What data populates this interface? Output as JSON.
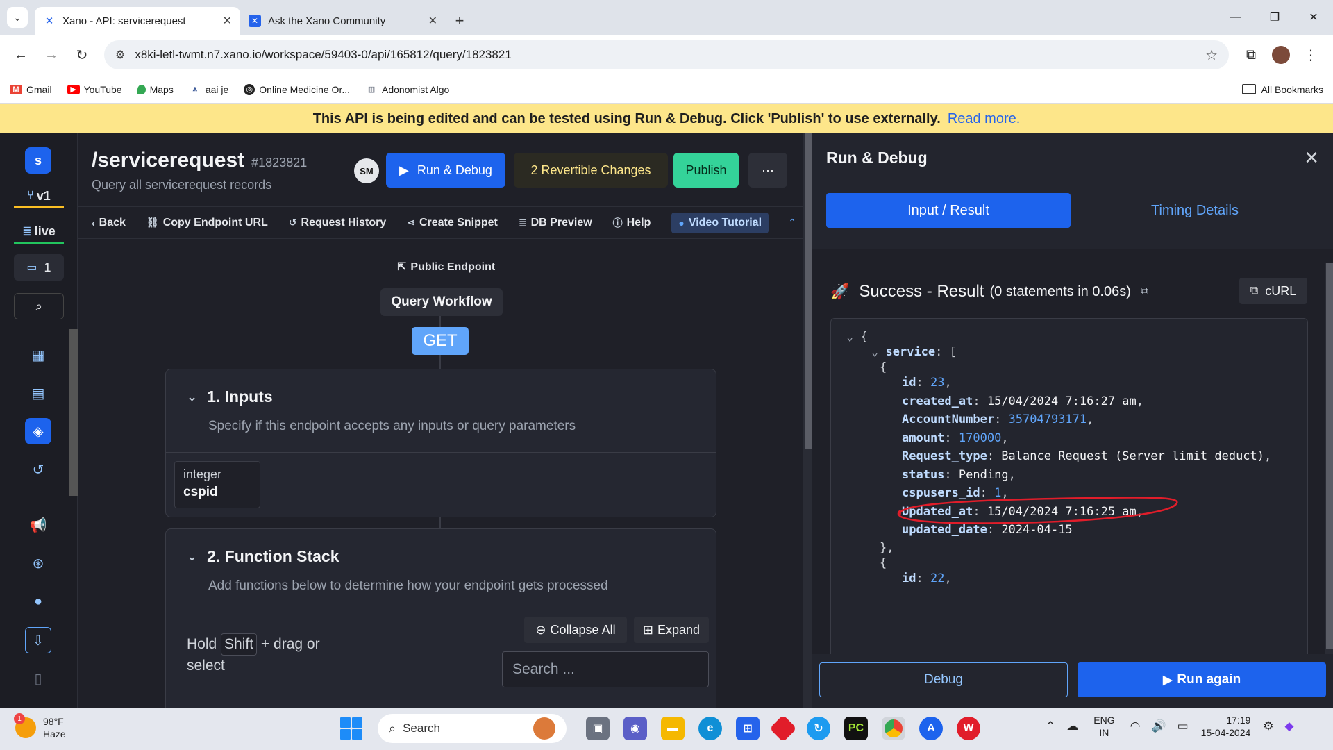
{
  "browser": {
    "tabs": [
      {
        "label": "Xano - API: servicerequest",
        "active": true
      },
      {
        "label": "Ask the Xano Community",
        "active": false
      }
    ],
    "url": "x8ki-letl-twmt.n7.xano.io/workspace/59403-0/api/165812/query/1823821",
    "bookmarks": [
      {
        "label": "Gmail",
        "color": "#ea4335",
        "icon": "gmail-icon"
      },
      {
        "label": "YouTube",
        "color": "#ff0000",
        "icon": "youtube-icon"
      },
      {
        "label": "Maps",
        "color": "#34a853",
        "icon": "maps-icon"
      },
      {
        "label": "aai je",
        "color": "#3b5998",
        "icon": "aai-icon"
      },
      {
        "label": "Online Medicine Or...",
        "color": "#222222",
        "icon": "globe-icon"
      },
      {
        "label": "Adonomist Algo",
        "color": "#6b7280",
        "icon": "chart-icon"
      }
    ],
    "all_bookmarks": "All Bookmarks"
  },
  "banner": {
    "text": "This API is being edited and can be tested using Run & Debug. Click 'Publish' to use externally.",
    "link": "Read more."
  },
  "sidebar": {
    "workspace_badge": "s",
    "branch": "v1",
    "env": "live",
    "comments": "1"
  },
  "editor": {
    "title": "/servicerequest",
    "id": "#1823821",
    "subtitle": "Query all servicerequest records",
    "user_initials": "SM",
    "run_debug": "Run & Debug",
    "revertible": "2 Revertible Changes",
    "publish": "Publish",
    "more": "···",
    "toolbar": {
      "back": "Back",
      "copy_url": "Copy Endpoint URL",
      "history": "Request History",
      "snippet": "Create Snippet",
      "db_preview": "DB Preview",
      "help": "Help",
      "video": "Video Tutorial"
    },
    "public_endpoint": "Public Endpoint",
    "query_workflow": "Query Workflow",
    "method": "GET",
    "inputs": {
      "title": "1. Inputs",
      "desc": "Specify if this endpoint accepts any inputs or query parameters",
      "param_type": "integer",
      "param_name": "cspid"
    },
    "function_stack": {
      "title": "2. Function Stack",
      "desc": "Add functions below to determine how your endpoint gets processed",
      "hold": "Hold",
      "shift": "Shift",
      "hold_rest1": "+ drag or",
      "hold_rest2": "select",
      "collapse_all": "Collapse All",
      "expand": "Expand",
      "search_placeholder": "Search ..."
    }
  },
  "run_debug": {
    "title": "Run & Debug",
    "tab_input": "Input / Result",
    "tab_timing": "Timing Details",
    "result_label": "Success - Result",
    "statements": "(0 statements in 0.06s)",
    "curl": "cURL",
    "json": {
      "service_key": "service",
      "record": {
        "id": "23",
        "created_at": "15/04/2024 7:16:27 am",
        "AccountNumber": "35704793171",
        "amount": "170000",
        "Request_type": "Balance Request (Server limit deduct)",
        "status": "Pending",
        "cspusers_id": "1",
        "Updated_at": "15/04/2024 7:16:25 am",
        "updated_date": "2024-04-15"
      },
      "next_id": "22"
    },
    "debug": "Debug",
    "run_again": "Run again"
  },
  "taskbar": {
    "weather_temp": "98°F",
    "weather_desc": "Haze",
    "weather_badge": "1",
    "search": "Search",
    "lang_top": "ENG",
    "lang_bottom": "IN",
    "time": "17:19",
    "date": "15-04-2024"
  }
}
